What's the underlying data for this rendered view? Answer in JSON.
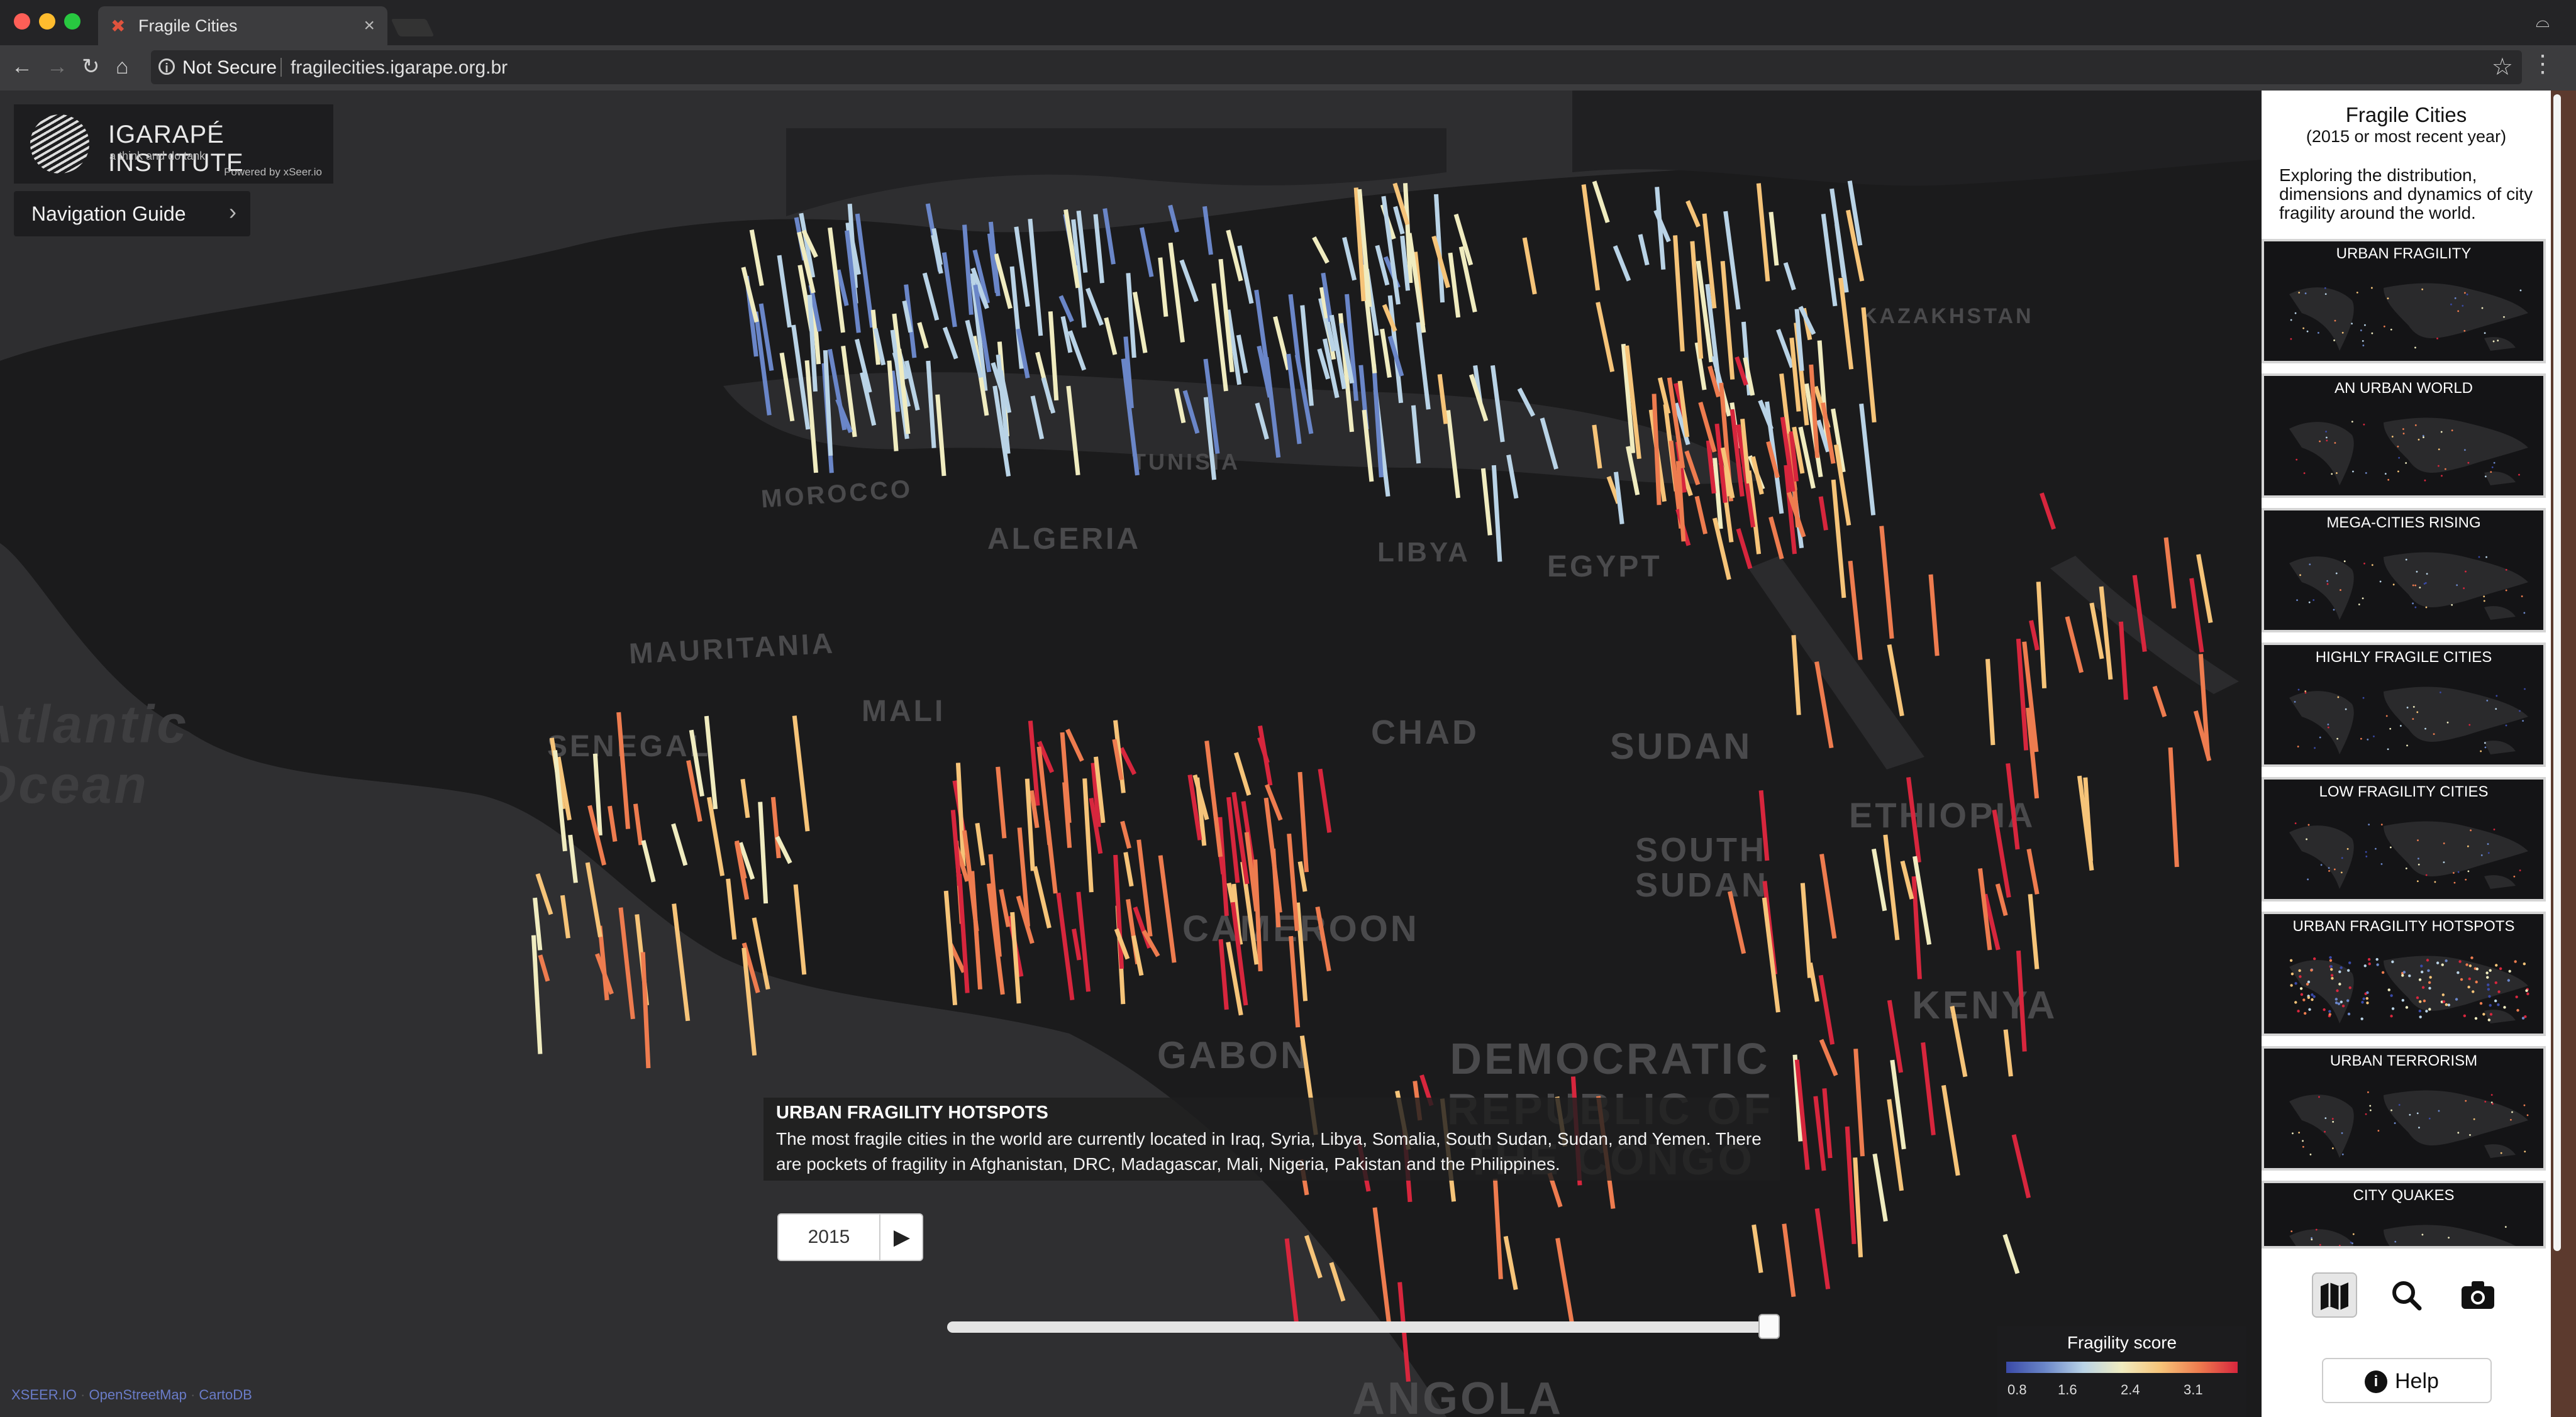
{
  "browser": {
    "tab_title": "Fragile Cities",
    "security_label": "Not Secure",
    "url": "fragilecities.igarape.org.br"
  },
  "logo": {
    "name": "IGARAPÉ INSTITUTE",
    "tagline": "a think and do tank",
    "powered_by": "Powered by xSeer.io"
  },
  "nav_guide_label": "Navigation Guide",
  "map_labels": {
    "morocco": "MOROCCO",
    "algeria": "ALGERIA",
    "libya": "LIBYA",
    "tunisia": "TUNISIA",
    "egypt": "EGYPT",
    "mauritania": "MAURITANIA",
    "mali": "MALI",
    "chad": "CHAD",
    "sudan": "SUDAN",
    "south_sudan": "SOUTH SUDAN",
    "ethiopia": "ETHIOPIA",
    "senegal": "SENEGAL",
    "cameroon": "CAMEROON",
    "gabon": "GABON",
    "drc": "DEMOCRATIC REPUBLIC OF THE CONGO",
    "kenya": "KENYA",
    "kazakhstan": "KAZAKHSTAN",
    "angola": "ANGOLA",
    "ocean": "Atlantic Ocean"
  },
  "info_panel": {
    "title": "URBAN FRAGILITY HOTSPOTS",
    "text": "The most fragile cities in the world are currently located in Iraq, Syria, Libya, Somalia, South Sudan, Sudan, and Yemen. There are pockets of fragility in Afghanistan, DRC, Madagascar, Mali, Nigeria, Pakistan and the Philippines."
  },
  "timeline": {
    "year": "2015",
    "position": 1.0
  },
  "legend": {
    "title": "Fragility score",
    "ticks": [
      "0.8",
      "1.6",
      "2.4",
      "3.1"
    ],
    "colors": [
      "#3a4aa8",
      "#6a86c8",
      "#b9d3e6",
      "#f0ecc0",
      "#f6c479",
      "#ee7c4f",
      "#d7263d"
    ]
  },
  "credits": {
    "xseer": "XSEER.IO",
    "osm": "OpenStreetMap",
    "carto": "CartoDB"
  },
  "sidebar": {
    "title": "Fragile Cities",
    "subtitle": "(2015 or most recent year)",
    "description": "Exploring the distribution, dimensions and dynamics of city fragility around the world.",
    "stories": [
      {
        "label": "URBAN FRAGILITY"
      },
      {
        "label": "AN URBAN WORLD"
      },
      {
        "label": "MEGA-CITIES RISING"
      },
      {
        "label": "HIGHLY FRAGILE CITIES"
      },
      {
        "label": "LOW FRAGILITY CITIES"
      },
      {
        "label": "URBAN FRAGILITY HOTSPOTS"
      },
      {
        "label": "URBAN TERRORISM"
      },
      {
        "label": "CITY QUAKES"
      }
    ],
    "help_label": "Help",
    "icons": [
      "map-icon",
      "search-icon",
      "camera-icon"
    ]
  }
}
